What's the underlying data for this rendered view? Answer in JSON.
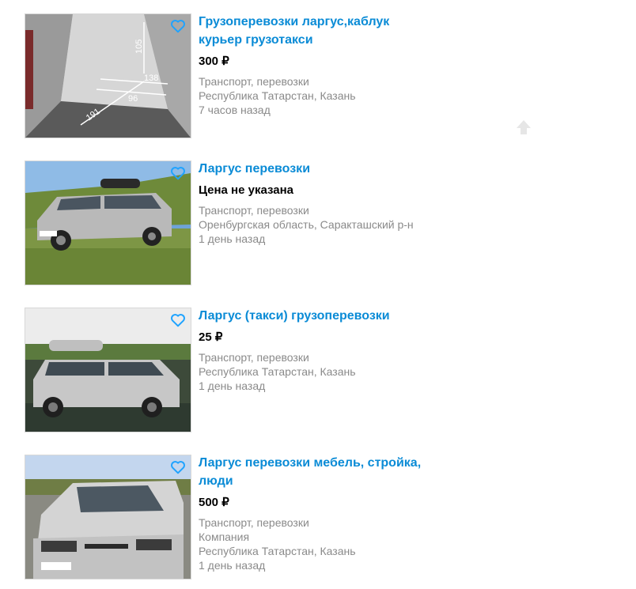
{
  "listings": [
    {
      "title": "Грузоперевозки ларгус,каблук курьер грузотакси",
      "price": "300 ₽",
      "category": "Транспорт, перевозки",
      "location": "Республика Татарстан, Казань",
      "time": "7 часов назад",
      "image": "van-cargo-interior-with-dimensions",
      "dimension_labels": [
        "105",
        "138",
        "96",
        "191"
      ]
    },
    {
      "title": "Ларгус перевозки",
      "price": "Цена не указана",
      "category": "Транспорт, перевозки",
      "location": "Оренбургская область, Саракташский р-н",
      "time": "1 день назад",
      "image": "silver-station-wagon-on-grass"
    },
    {
      "title": "Ларгус (такси) грузоперевозки",
      "price": "25 ₽",
      "category": "Транспорт, перевозки",
      "location": "Республика Татарстан, Казань",
      "time": "1 день назад",
      "image": "silver-station-wagon-taxi-roof-box"
    },
    {
      "title": "Ларгус перевозки мебель, стройка, люди",
      "price": "500 ₽",
      "category": "Транспорт, перевозки",
      "seller_type": "Компания",
      "location": "Республика Татарстан, Казань",
      "time": "1 день назад",
      "image": "silver-station-wagon-front-view"
    }
  ],
  "icons": {
    "favorite": "heart-outline-icon",
    "scroll_top": "arrow-up-icon"
  },
  "colors": {
    "title_link": "#0a8bd6",
    "meta_text": "#8a8a8a",
    "price_text": "#000000",
    "favorite_icon": "#1fa3ff"
  }
}
